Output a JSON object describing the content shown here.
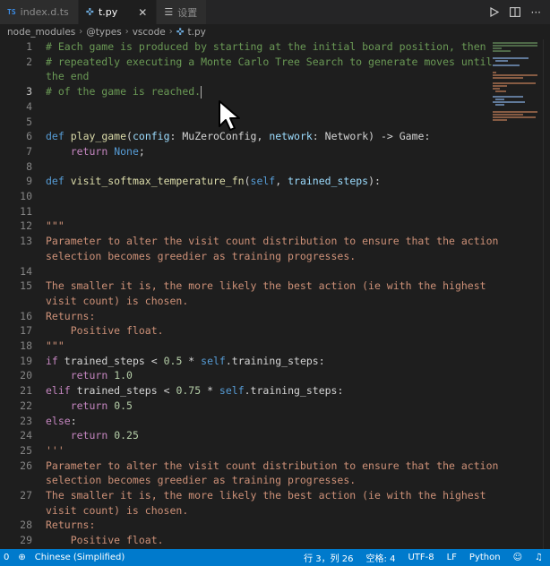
{
  "tabs": [
    {
      "badge": "TS",
      "label": "index.d.ts",
      "active": false
    },
    {
      "label": "t.py",
      "active": true
    },
    {
      "label": "设置",
      "active": false
    }
  ],
  "breadcrumb": [
    "node_modules",
    "@types",
    "vscode",
    "t.py"
  ],
  "lines": [
    {
      "n": "1"
    },
    {
      "n": "2"
    },
    {
      "n": ""
    },
    {
      "n": "3",
      "active": true
    },
    {
      "n": "4"
    },
    {
      "n": "5"
    },
    {
      "n": "6"
    },
    {
      "n": "7"
    },
    {
      "n": "8"
    },
    {
      "n": "9"
    },
    {
      "n": "10"
    },
    {
      "n": "11"
    },
    {
      "n": "12"
    },
    {
      "n": "13"
    },
    {
      "n": ""
    },
    {
      "n": "14"
    },
    {
      "n": "15"
    },
    {
      "n": ""
    },
    {
      "n": "16"
    },
    {
      "n": "17"
    },
    {
      "n": "18"
    },
    {
      "n": "19"
    },
    {
      "n": "20"
    },
    {
      "n": "21"
    },
    {
      "n": "22"
    },
    {
      "n": "23"
    },
    {
      "n": "24"
    },
    {
      "n": "25"
    },
    {
      "n": "26"
    },
    {
      "n": ""
    },
    {
      "n": "27"
    },
    {
      "n": ""
    },
    {
      "n": "28"
    },
    {
      "n": "29"
    }
  ],
  "code": {
    "l1": "# Each game is produced by starting at the initial board position, then",
    "l2": "# repeatedly executing a Monte Carlo Tree Search to generate moves until",
    "l2b": "the end",
    "l3": "# of the game is reached.",
    "l6_def": "def",
    "l6_fn": "play_game",
    "l6_p1": "config",
    "l6_t1": "MuZeroConfig",
    "l6_p2": "network",
    "l6_t2": "Network",
    "l6_arrow": ") -> ",
    "l6_ret": "Game",
    "l7_ret": "return",
    "l7_none": "None",
    "l9_def": "def",
    "l9_fn": "visit_softmax_temperature_fn",
    "l9_self": "self",
    "l9_p": "trained_steps",
    "l12": "\"\"\"",
    "l13": "Parameter to alter the visit count distribution to ensure that the action",
    "l13b": "selection becomes greedier as training progresses.",
    "l15": "The smaller it is, the more likely the best action (ie with the highest",
    "l15b": "visit count) is chosen.",
    "l16": "Returns:",
    "l17": "    Positive float.",
    "l18": "\"\"\"",
    "l19_if": "if",
    "l19_var": "trained_steps",
    "l19_lt": " < ",
    "l19_num": "0.5",
    "l19_mul": " * ",
    "l19_self": "self",
    "l19_attr": ".training_steps:",
    "l20_ret": "return",
    "l20_num": "1.0",
    "l21_elif": "elif",
    "l21_num": "0.75",
    "l22_num": "0.5",
    "l23_else": "else",
    "l24_num": "0.25",
    "l25": "'''",
    "l26": "Parameter to alter the visit count distribution to ensure that the action",
    "l26b": "selection becomes greedier as training progresses.",
    "l27": "The smaller it is, the more likely the best action (ie with the highest",
    "l27b": "visit count) is chosen.",
    "l28": "Returns:",
    "l29": "    Positive float."
  },
  "status": {
    "left_count": "0",
    "language_pack": "Chinese (Simplified)",
    "cursor_pos": "行 3，列 26",
    "indent": "空格: 4",
    "encoding": "UTF-8",
    "eol": "LF",
    "mode": "Python"
  },
  "icons": {
    "run": "play-icon",
    "split": "split-editor-icon",
    "more": "more-icon",
    "pointer": "mouse-pointer-icon"
  },
  "colors": {
    "accent": "#007acc",
    "comment": "#6a9955",
    "keyword": "#569cd6",
    "string": "#ce9178"
  }
}
